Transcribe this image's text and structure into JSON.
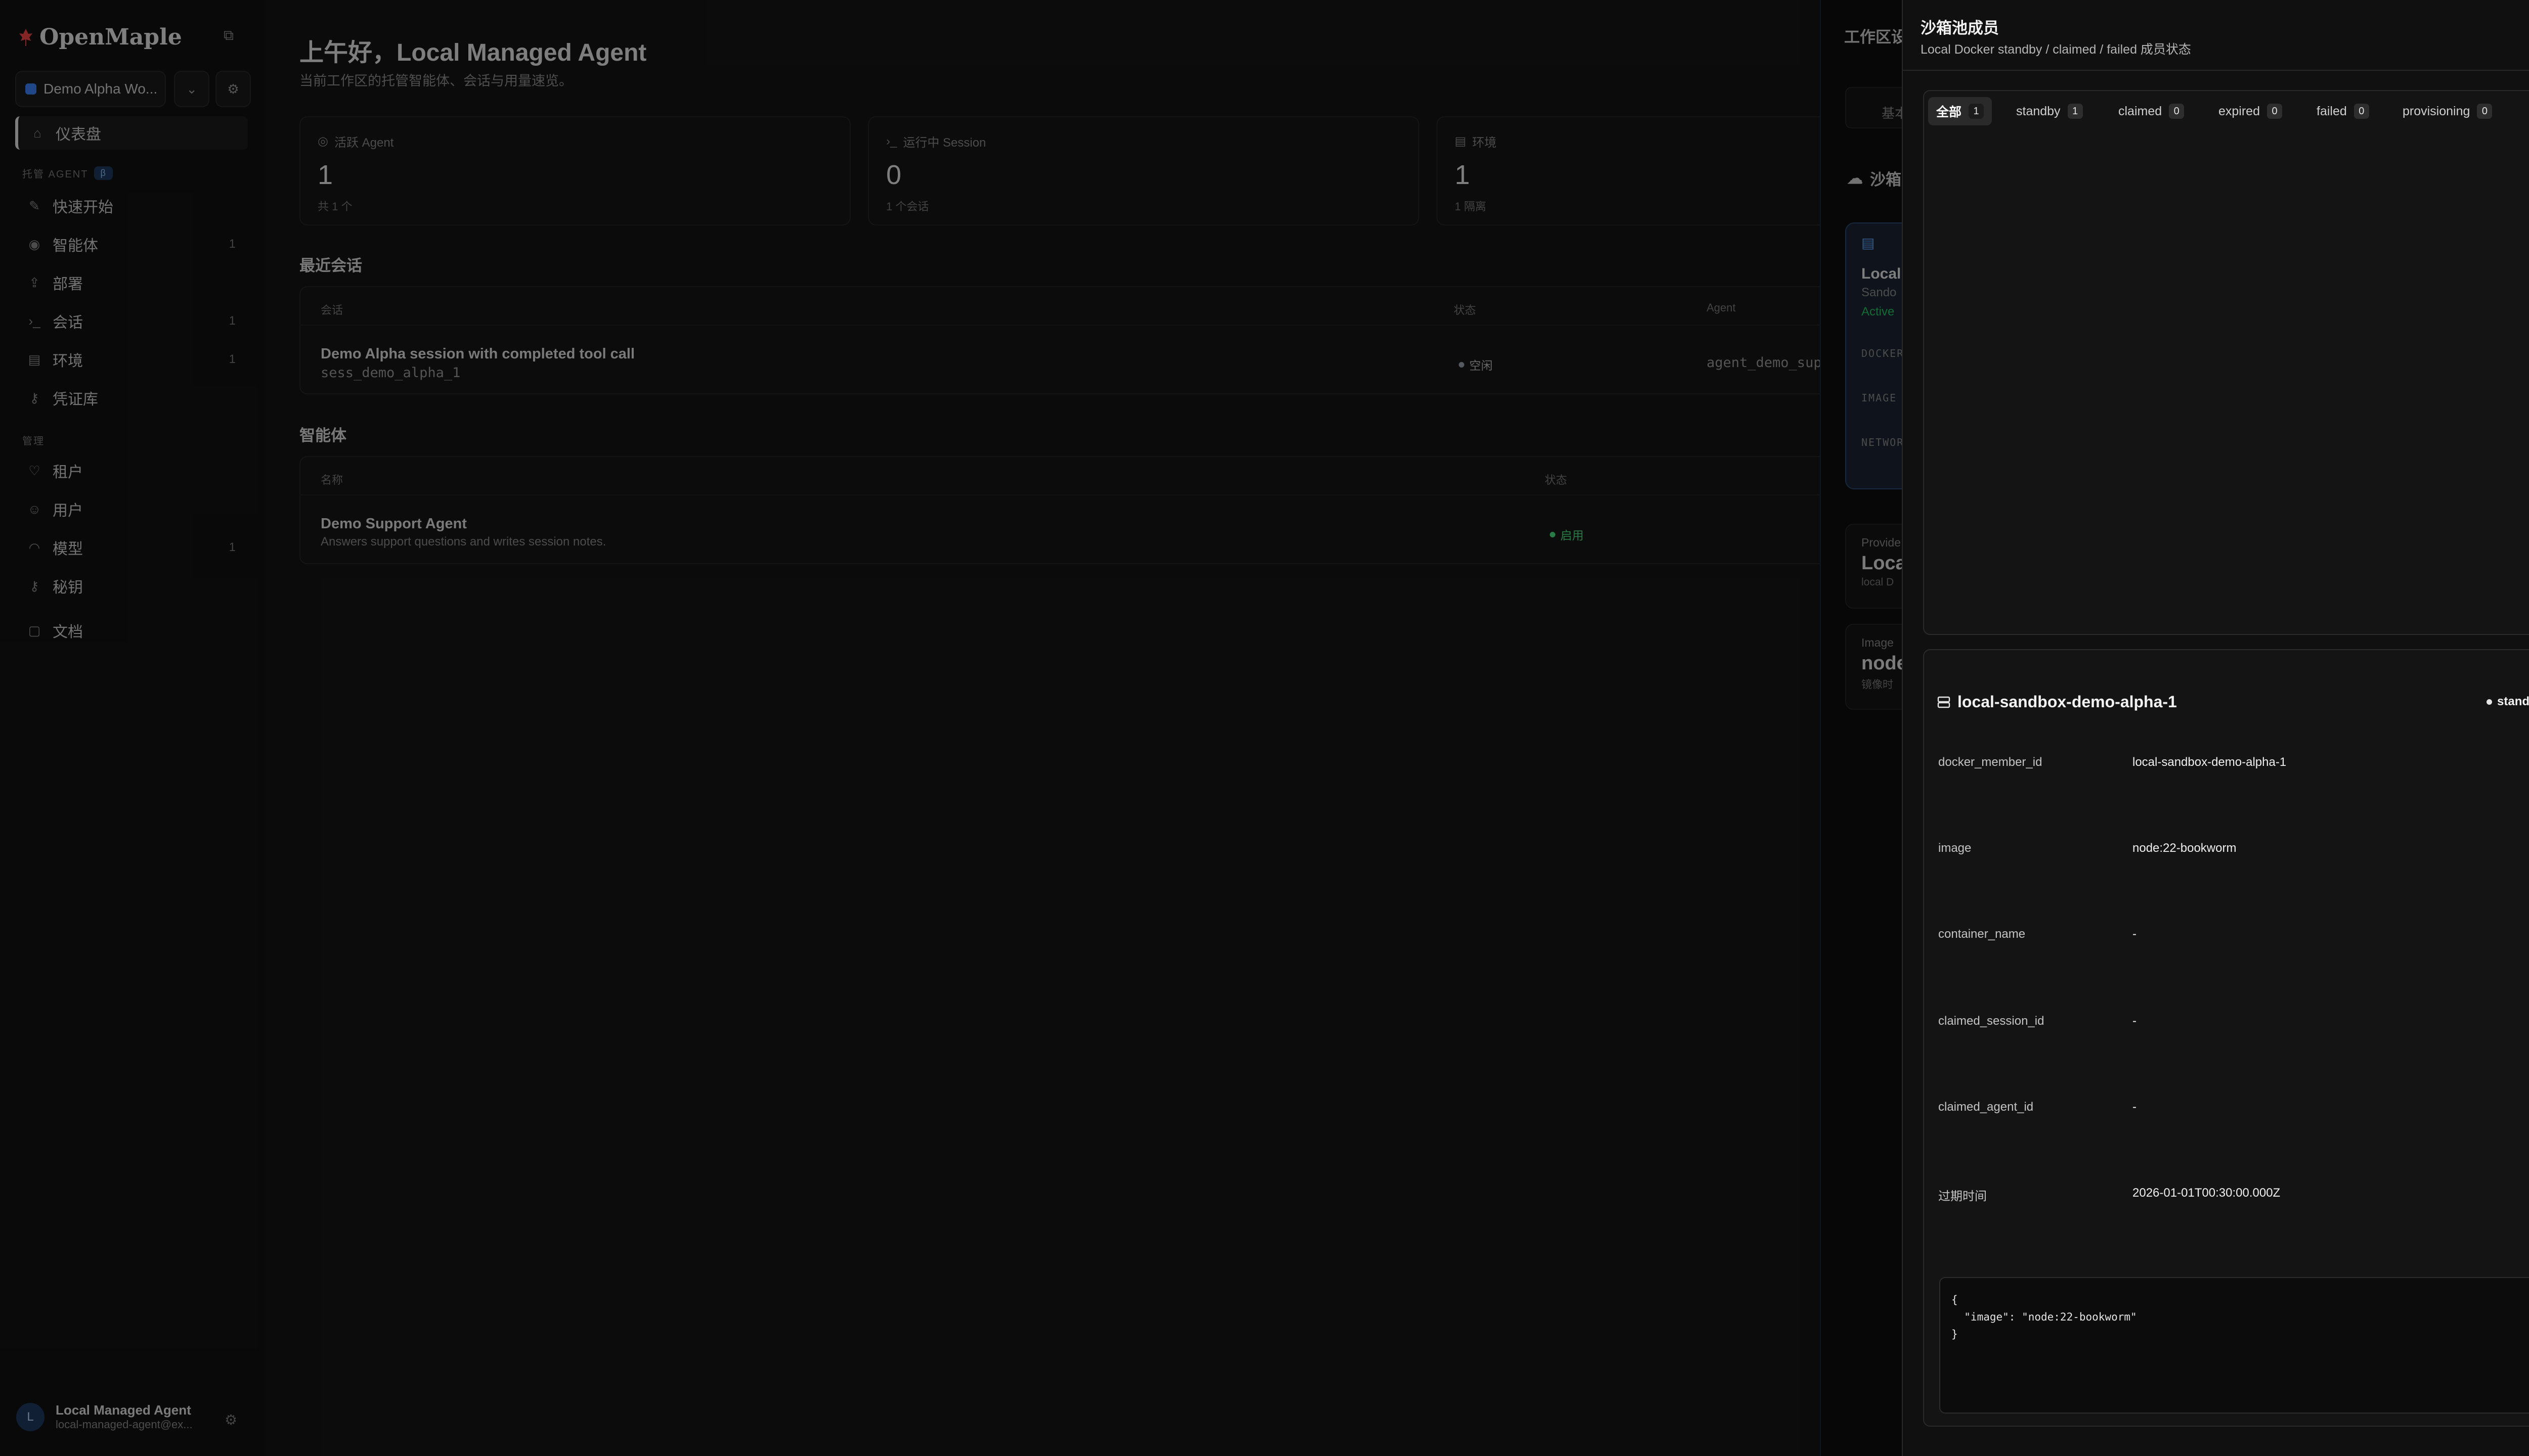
{
  "app": {
    "name": "OpenMaple"
  },
  "sidebar": {
    "workspace": "Demo Alpha Wo...",
    "items_top": [
      {
        "label": "仪表盘",
        "icon": "home-icon"
      }
    ],
    "section_agent": {
      "label": "托管 AGENT",
      "badge": "β"
    },
    "items_agent": [
      {
        "label": "快速开始",
        "count": "",
        "icon": "wand-icon"
      },
      {
        "label": "智能体",
        "count": "1",
        "icon": "bot-icon"
      },
      {
        "label": "部署",
        "count": "",
        "icon": "deploy-icon"
      },
      {
        "label": "会话",
        "count": "1",
        "icon": "terminal-icon"
      },
      {
        "label": "环境",
        "count": "1",
        "icon": "server-icon"
      },
      {
        "label": "凭证库",
        "count": "",
        "icon": "key-icon"
      }
    ],
    "section_admin": {
      "label": "管理"
    },
    "items_admin": [
      {
        "label": "租户",
        "count": "",
        "icon": "tenant-icon"
      },
      {
        "label": "用户",
        "count": "",
        "icon": "users-icon"
      },
      {
        "label": "模型",
        "count": "1",
        "icon": "model-icon"
      },
      {
        "label": "秘钥",
        "count": "",
        "icon": "secret-key-icon"
      }
    ],
    "docs": {
      "label": "文档"
    },
    "user": {
      "initial": "L",
      "name": "Local Managed Agent",
      "email": "local-managed-agent@ex..."
    }
  },
  "dashboard": {
    "greeting": "上午好，Local Managed Agent",
    "subtitle": "当前工作区的托管智能体、会话与用量速览。",
    "stats": [
      {
        "label": "活跃 Agent",
        "value": "1",
        "sub": "共 1 个"
      },
      {
        "label": "运行中 Session",
        "value": "0",
        "sub": "1 个会话"
      },
      {
        "label": "环境",
        "value": "1",
        "sub": "1 隔离"
      }
    ],
    "recent_sessions": {
      "title": "最近会话",
      "headers": [
        "会话",
        "状态",
        "Agent"
      ],
      "rows": [
        {
          "title": "Demo Alpha session with completed tool call",
          "id": "sess_demo_alpha_1",
          "status": "空闲",
          "agent": "agent_demo_supp"
        }
      ]
    },
    "agents": {
      "title": "智能体",
      "headers": [
        "名称",
        "状态"
      ],
      "rows": [
        {
          "title": "Demo Support Agent",
          "desc": "Answers support questions and writes session notes.",
          "status": "启用"
        }
      ]
    }
  },
  "settings_panel": {
    "title": "工作区设",
    "tab": "基本",
    "section": "沙箱",
    "card": {
      "title": "Local",
      "sub": "Sando",
      "status": "Active",
      "labels": [
        "DOCKER",
        "IMAGE",
        "NETWOR"
      ]
    },
    "info": [
      {
        "label": "Provide",
        "value": "Loca",
        "sub": "local D"
      },
      {
        "label": "Image",
        "value": "node",
        "sub": "镜像时"
      }
    ]
  },
  "drawer": {
    "title": "沙箱池成员",
    "subtitle": "Local Docker standby / claimed / failed 成员状态",
    "filters": [
      {
        "label": "全部",
        "count": "1"
      },
      {
        "label": "standby",
        "count": "1"
      },
      {
        "label": "claimed",
        "count": "0"
      },
      {
        "label": "expired",
        "count": "0"
      },
      {
        "label": "failed",
        "count": "0"
      },
      {
        "label": "provisioning",
        "count": "0"
      }
    ],
    "member": {
      "name": "local-sandbox-demo-alpha-1",
      "status": "standby",
      "fields": [
        {
          "key": "docker_member_id",
          "value": "local-sandbox-demo-alpha-1"
        },
        {
          "key": "image",
          "value": "node:22-bookworm"
        },
        {
          "key": "container_name",
          "value": "-"
        },
        {
          "key": "claimed_session_id",
          "value": "-"
        },
        {
          "key": "claimed_agent_id",
          "value": "-"
        },
        {
          "key": "过期时间",
          "value": "2026-01-01T00:30:00.000Z"
        }
      ],
      "json": "{\n  \"image\": \"node:22-bookworm\"\n}"
    }
  }
}
